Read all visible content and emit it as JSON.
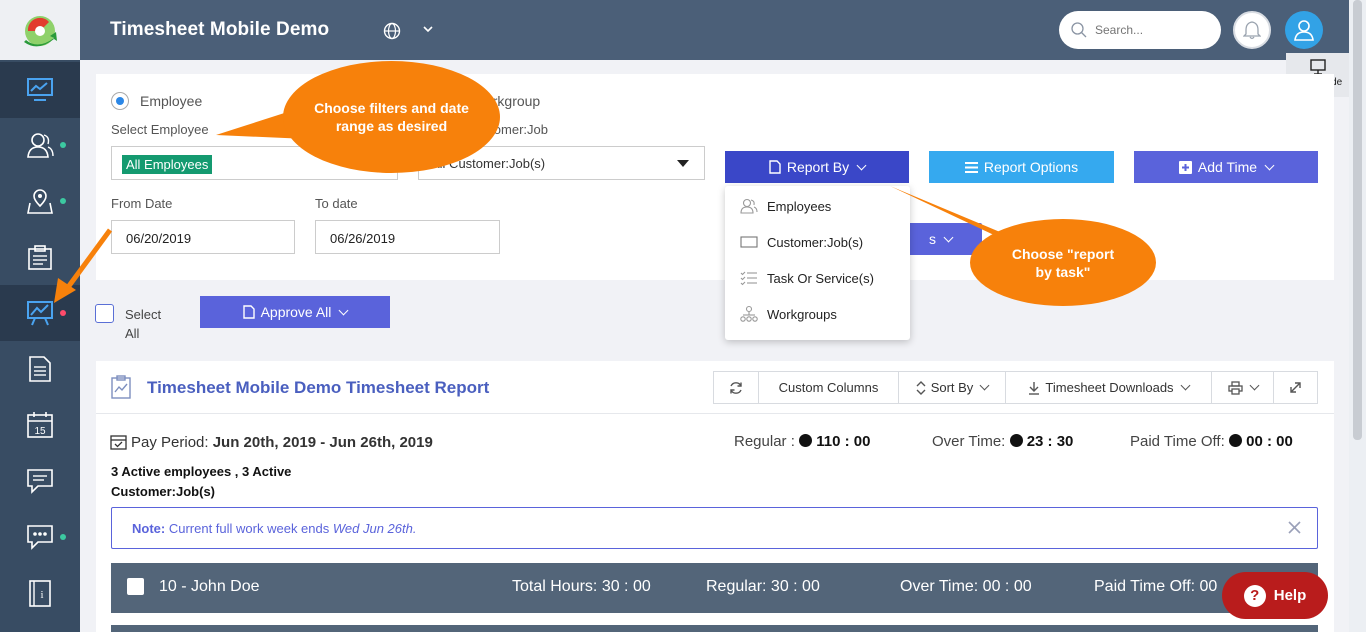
{
  "header": {
    "app_title": "Timesheet Mobile Demo",
    "search_placeholder": "Search...",
    "page_guide": "page guide"
  },
  "sidebar": {
    "items": [
      {
        "icon": "dashboard-icon",
        "active": false
      },
      {
        "icon": "users-icon",
        "dot": "green"
      },
      {
        "icon": "map-icon",
        "dot": "green"
      },
      {
        "icon": "clipboard-icon"
      },
      {
        "icon": "reports-chart-icon",
        "active": true,
        "dot": "red"
      },
      {
        "icon": "document-icon"
      },
      {
        "icon": "calendar-icon",
        "calendar_day": "15"
      },
      {
        "icon": "chat-icon"
      },
      {
        "icon": "messages-icon",
        "dot": "green"
      },
      {
        "icon": "book-icon"
      }
    ]
  },
  "filters": {
    "radio_employee": "Employee",
    "radio_workgroup": "Workgroup",
    "select_employee_label": "Select Employee",
    "customer_job_label": "Customer:Job",
    "employee_tag": "All Employees",
    "customer_value": "All Customer:Job(s)",
    "from_label": "From Date",
    "to_label": "To date",
    "from_date": "06/20/2019",
    "to_date": "06/26/2019",
    "report_by": "Report By",
    "report_options": "Report Options",
    "add_time": "Add Time",
    "hidden_button_tail": "s"
  },
  "report_by_menu": [
    {
      "icon": "employees-icon",
      "label": "Employees"
    },
    {
      "icon": "customer-job-icon",
      "label": "Customer:Job(s)"
    },
    {
      "icon": "task-list-icon",
      "label": "Task Or Service(s)"
    },
    {
      "icon": "workgroups-icon",
      "label": "Workgroups"
    }
  ],
  "actions": {
    "select_all": "Select",
    "select_all_2": "All",
    "approve_all": "Approve All"
  },
  "report": {
    "title": "Timesheet Mobile Demo Timesheet Report",
    "custom_columns": "Custom Columns",
    "sort_by": "Sort By",
    "downloads": "Timesheet Downloads",
    "pay_period_label": "Pay Period:",
    "pay_period_value": "Jun 20th, 2019 - Jun 26th, 2019",
    "regular_label": "Regular :",
    "regular_value": "110 : 00",
    "overtime_label": "Over Time:",
    "overtime_value": "23 : 30",
    "pto_label": "Paid Time Off:",
    "pto_value": "00 : 00",
    "active_line1": "3 Active employees , 3 Active",
    "active_line2": "Customer:Job(s)",
    "note_label": "Note:",
    "note_text": "Current full work week ends",
    "note_date": "Wed Jun 26th."
  },
  "employee_row": {
    "name": "10 - John Doe",
    "total": "Total Hours: 30 : 00",
    "regular": "Regular: 30 : 00",
    "overtime": "Over Time: 00 : 00",
    "pto": "Paid Time Off: 00"
  },
  "callouts": {
    "filters": "Choose filters and date range as desired",
    "report_by_task": "Choose \"report by task\""
  },
  "help": "Help",
  "colors": {
    "sidebar": "#384c63",
    "header": "#4b5f78",
    "callout": "#f7810b",
    "primary_blue": "#3a47c8",
    "help_red": "#b91c1c"
  }
}
